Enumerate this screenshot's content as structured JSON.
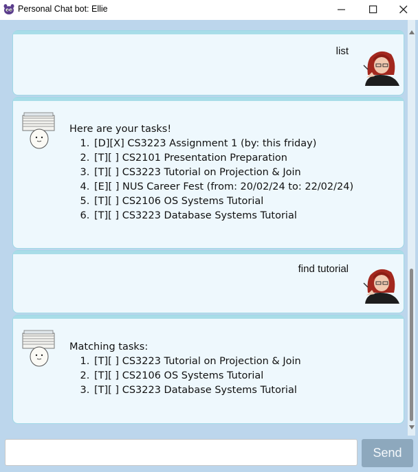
{
  "window": {
    "title": "Personal Chat bot: Ellie"
  },
  "messages": [
    {
      "sender": "user",
      "text": "list"
    },
    {
      "sender": "bot",
      "heading": "Here are your tasks!",
      "items": [
        "[D][X] CS3223 Assignment 1 (by: this friday)",
        "[T][ ] CS2101 Presentation Preparation",
        "[T][ ] CS3223 Tutorial on Projection & Join",
        "[E][ ] NUS Career Fest (from: 20/02/24 to: 22/02/24)",
        "[T][ ] CS2106 OS Systems Tutorial",
        "[T][ ] CS3223 Database Systems Tutorial"
      ]
    },
    {
      "sender": "user",
      "text": "find tutorial"
    },
    {
      "sender": "bot",
      "heading": "Matching tasks:",
      "items": [
        "[T][ ] CS3223 Tutorial on Projection & Join",
        "[T][ ] CS2106 OS Systems Tutorial",
        "[T][ ] CS3223 Database Systems Tutorial"
      ]
    }
  ],
  "input": {
    "value": "",
    "send_label": "Send"
  },
  "colors": {
    "chat_background": "#bcd6ec",
    "bubble_background": "#eef8fd",
    "bubble_border": "#9fd8e6",
    "send_button": "#8da8bd"
  },
  "icons": {
    "app": "purple-creature-icon",
    "user_avatar": "red-haired-girl-avatar",
    "bot_avatar": "paper-stack-character-avatar"
  }
}
